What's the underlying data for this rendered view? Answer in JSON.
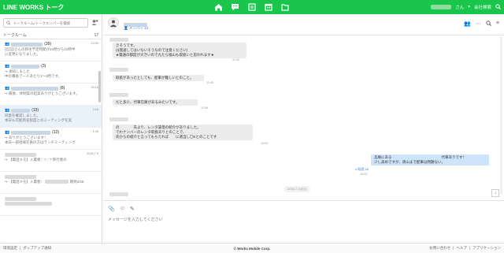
{
  "app": {
    "title": "LINE WORKS トーク"
  },
  "topbar": {
    "nav_icons": [
      "home-icon",
      "talk-icon",
      "board-icon",
      "calendar-icon",
      "drive-icon"
    ],
    "user_suffix": "さん",
    "company_label": "会社検索"
  },
  "sidebar": {
    "search_placeholder": "トークルーム/トークメンバーを検索",
    "rooms_label": "トークルーム",
    "rooms_count": "17",
    "rooms": [
      {
        "count": "(39)",
        "time": "10:00",
        "preview1": "さんの移住予定時間が10時から10時半",
        "preview2": "に変更になりました。",
        "active": false
      },
      {
        "count": "(3)",
        "time": "",
        "preview1": "承知しました",
        "preview2": "中の番長で一人あたり2～3時です。",
        "active": false
      },
      {
        "count": "(8)",
        "time": "09:16",
        "preview1": "最後、体制案の起案ありがとうございます。",
        "preview2": "",
        "active": false
      },
      {
        "count": "(13)",
        "time": "1:15",
        "preview1": "同意を確認しました。",
        "preview2": "本日も可能両名程度とのミーティングを実",
        "active": true
      },
      {
        "count": "(12)",
        "time": "1:26",
        "preview1": "ありがとうございます！",
        "preview2": "本日一部地域在員の方はランチミーティング",
        "active": false
      },
      {
        "count": "",
        "time": "2018.7.9",
        "preview1": "【電話メモ】入電者：7／7 移行者の",
        "preview2": "",
        "active": false
      },
      {
        "count": "",
        "time": "",
        "preview1": "【電話メモ】入電者：",
        "preview2": "",
        "extra": "期待2/26",
        "active": false
      },
      {
        "count": "",
        "time": "",
        "preview1": "",
        "preview2": "",
        "active": false
      }
    ]
  },
  "chat": {
    "member_label": "メンバー",
    "member_count": "13",
    "messages": [
      {
        "lines": [
          "さそうです。",
          "は発送してはいないそうなので注意ください)",
          "★電通の都度が大きいので九たら福山も取扱いと思われます★"
        ],
        "time": "11:42"
      },
      {
        "lines": [
          "取扱があったとしても、配車が難しいとのこと。"
        ],
        "time": "11:45"
      },
      {
        "lines": [
          "だと多少、代車在庫があるみたいです。"
        ],
        "time": "11:59"
      },
      {
        "lines": [
          "の　　　　氏より、レンタ賃借の紹介がありました。",
          "でわナンバーのレンタ取扱ありとのことで、",
          "氏からの紹介と言ってもらえれば　　に適当し〇Kとのことです"
        ],
        "time": "13:00"
      },
      {
        "lines": [
          "兵庫にある　　　　　　　　　　　　　　代車ありです！",
          "少し高めですが、周山まで配車は問題ない。"
        ],
        "time": "16:02",
        "mine": true
      }
    ],
    "read_label": "4 既読 16",
    "date_separator": "2018.7.10(火)",
    "input_placeholder": "メッセージを入力してください"
  },
  "footer": {
    "left": [
      "環境設定",
      "ポップアップ通知"
    ],
    "center": "© Works Mobile Corp.",
    "right": [
      "お問い合わせ",
      "ヘルプ",
      "アプリケーション"
    ]
  },
  "colors": {
    "brand_green": "#19c54b",
    "my_bubble": "#cde4fb",
    "other_bubble": "#ececec",
    "accent_blue": "#3b7ad1"
  }
}
